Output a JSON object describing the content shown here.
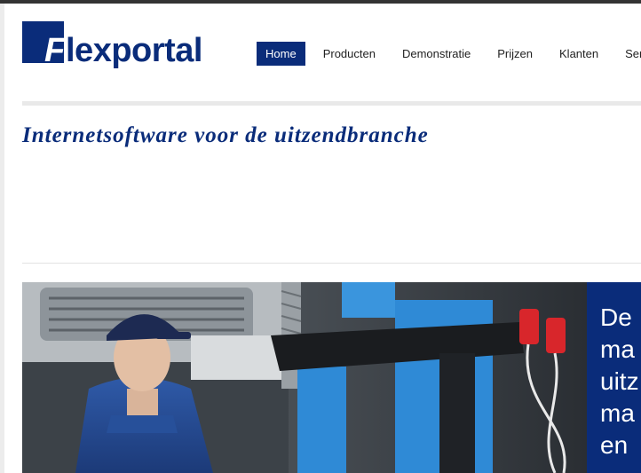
{
  "logo": {
    "letter": "F",
    "rest": "lexportal",
    "color": "#0a2c7a"
  },
  "nav": {
    "items": [
      {
        "label": "Home",
        "active": true
      },
      {
        "label": "Producten",
        "active": false
      },
      {
        "label": "Demonstratie",
        "active": false
      },
      {
        "label": "Prijzen",
        "active": false
      },
      {
        "label": "Klanten",
        "active": false
      },
      {
        "label": "Service",
        "active": false
      }
    ]
  },
  "tagline": "Internetsoftware voor de uitzendbranche",
  "hero": {
    "lines": [
      "De",
      "ma",
      "uitz",
      "ma",
      "en"
    ]
  },
  "colors": {
    "brand": "#0a2c7a",
    "divider": "#e9e9e9"
  }
}
